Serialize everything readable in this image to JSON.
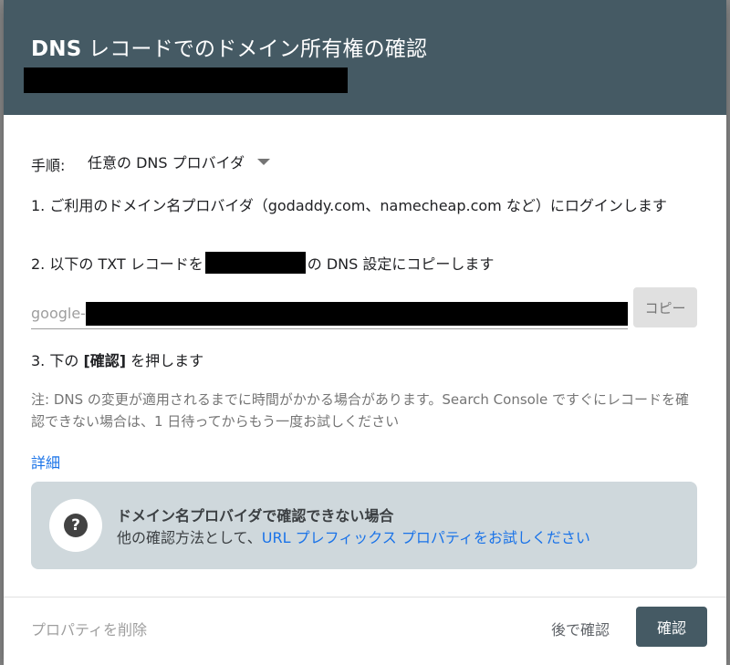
{
  "dialog": {
    "title_bold": "DNS",
    "title_rest": " レコードでのドメイン所有権の確認"
  },
  "procedure": {
    "label": "手順:",
    "selected": "任意の DNS プロバイダ"
  },
  "steps": {
    "step1": "1. ご利用のドメイン名プロバイダ（godaddy.com、namecheap.com など）にログインします",
    "step2_before": "2. 以下の TXT レコードを",
    "step2_after": "の DNS 設定にコピーします",
    "step3_before": "3. 下の ",
    "step3_bold": "[確認]",
    "step3_after": " を押します"
  },
  "record": {
    "prefix": "google-",
    "copy_label": "コピー"
  },
  "note": "注: DNS の変更が適用されるまでに時間がかかる場合があります。Search Console ですぐにレコードを確認できない場合は、1 日待ってからもう一度お試しください",
  "details_link": "詳細",
  "info_box": {
    "icon": "help-circle-icon",
    "icon_glyph": "?",
    "title": "ドメイン名プロバイダで確認できない場合",
    "text": "他の確認方法として、",
    "link": "URL プレフィックス プロパティをお試しください"
  },
  "footer": {
    "delete_label": "プロパティを削除",
    "later_label": "後で確認",
    "confirm_label": "確認"
  },
  "colors": {
    "header": "#455a64",
    "link": "#1a73e8",
    "info_box": "#cfd8dc"
  }
}
